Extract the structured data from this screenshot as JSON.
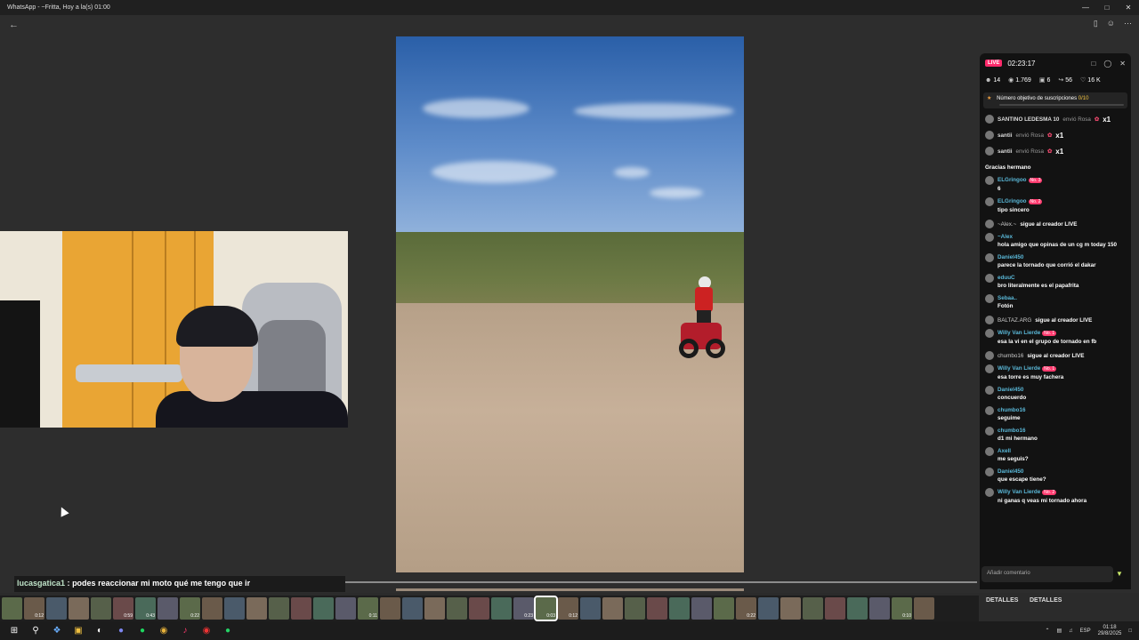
{
  "window": {
    "title": "WhatsApp - ~Fritta, Hoy a la(s) 01:00"
  },
  "overlay_comment": {
    "user": "lucasgatica1",
    "separator": ":",
    "message": "podes reaccionar mi moto qué me tengo que ir"
  },
  "live": {
    "badge": "LIVE",
    "timer": "02:23:17",
    "stats": {
      "users": "14",
      "views": "1.769",
      "gifts": "6",
      "shares": "56",
      "likes": "16 K"
    },
    "goal": {
      "label": "Número objetivo de suscripciones",
      "progress": "0/10"
    },
    "gifts": [
      {
        "name": "SANTINO LEDESMA 10",
        "action": "envió Rosa",
        "count": "x1"
      },
      {
        "name": "santii",
        "action": "envió Rosa",
        "count": "x1"
      },
      {
        "name": "santii",
        "action": "envió Rosa",
        "count": "x1"
      }
    ],
    "messages": [
      {
        "type": "msg",
        "name": "",
        "badge": "",
        "text": "Gracias hermano"
      },
      {
        "type": "msg",
        "name": "ELGringoo",
        "badge": "No. 3",
        "text": "6"
      },
      {
        "type": "msg",
        "name": "ELGringoo",
        "badge": "No. 2",
        "text": "tipo sincero"
      },
      {
        "type": "follow",
        "name": "~Alex.~",
        "text": "sigue al creador LIVE"
      },
      {
        "type": "msg",
        "name": "~Alex",
        "badge": "",
        "text": "hola amigo que opinas de un cg m today 150"
      },
      {
        "type": "msg",
        "name": "Daniel450",
        "badge": "",
        "text": "parece la tornado que corrió el dakar"
      },
      {
        "type": "msg",
        "name": "eduuC",
        "badge": "",
        "text": "bro literalmente es el papafrita"
      },
      {
        "type": "msg",
        "name": "Sebaa..",
        "badge": "",
        "text": "Fotón"
      },
      {
        "type": "follow",
        "name": "BALTAZ.ARG",
        "text": "sigue al creador LIVE"
      },
      {
        "type": "msg",
        "name": "Willy Van Lierde",
        "badge": "No. 1",
        "text": "esa la vi en el grupo de tornado en fb"
      },
      {
        "type": "follow",
        "name": "chumbo16",
        "text": "sigue al creador LIVE"
      },
      {
        "type": "msg",
        "name": "Willy Van Lierde",
        "badge": "No. 1",
        "text": "esa torre es muy fachera"
      },
      {
        "type": "msg",
        "name": "Daniel450",
        "badge": "",
        "text": "concuerdo"
      },
      {
        "type": "msg",
        "name": "chumbo16",
        "badge": "",
        "text": "seguime"
      },
      {
        "type": "msg",
        "name": "chumbo16",
        "badge": "",
        "text": "d1 mi hermano"
      },
      {
        "type": "msg",
        "name": "Axell",
        "badge": "",
        "text": "me seguis?"
      },
      {
        "type": "msg",
        "name": "Daniel450",
        "badge": "",
        "text": "que escape tiene?"
      },
      {
        "type": "msg",
        "name": "Willy Van Lierde",
        "badge": "No. 2",
        "text": "ni ganas q veas mi tornado ahora"
      }
    ],
    "input_placeholder": "Añadir comentario"
  },
  "strip": {
    "labels": [
      "0:12",
      "0:59",
      "0:43",
      "0:22",
      "0:11",
      "0:23",
      "0:03",
      "0:12",
      "0:22",
      "0:10"
    ],
    "details_1": "DETALLES",
    "details_2": "DETALLES"
  },
  "tray": {
    "lang": "ESP",
    "time": "01:18",
    "date": "29/8/2025"
  },
  "colors": {
    "live": "#ff2a6b",
    "username": "#5ab8d8",
    "badge": "#ff3a6e"
  }
}
